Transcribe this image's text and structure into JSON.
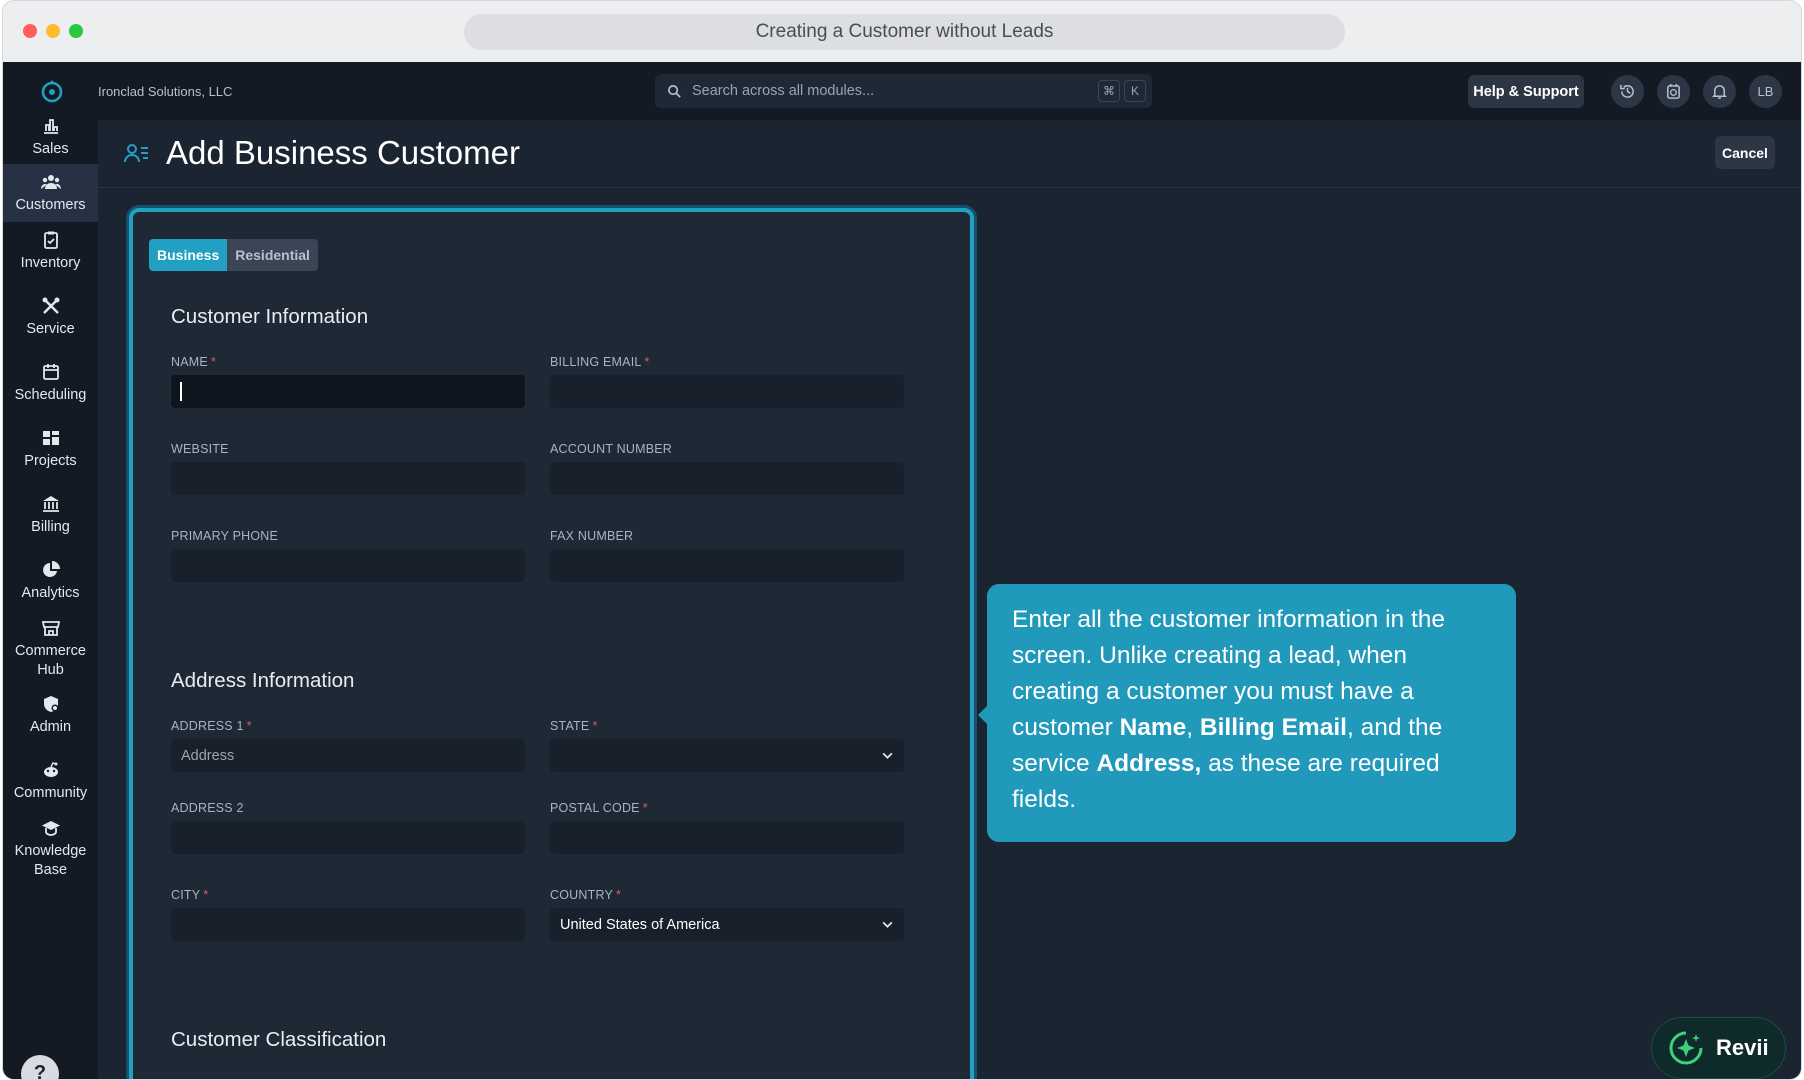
{
  "window": {
    "url_title": "Creating a Customer without Leads"
  },
  "topbar": {
    "company": "Ironclad Solutions, LLC",
    "search_placeholder": "Search across all modules...",
    "kbd_cmd": "⌘",
    "kbd_k": "K",
    "help_label": "Help & Support",
    "avatar_initials": "LB"
  },
  "sidebar": {
    "items": [
      {
        "label": "Sales",
        "icon": "bar-chart-icon"
      },
      {
        "label": "Customers",
        "icon": "users-icon",
        "active": true
      },
      {
        "label": "Inventory",
        "icon": "clipboard-check-icon"
      },
      {
        "label": "Service",
        "icon": "tools-icon"
      },
      {
        "label": "Scheduling",
        "icon": "calendar-icon"
      },
      {
        "label": "Projects",
        "icon": "projects-icon"
      },
      {
        "label": "Billing",
        "icon": "bank-icon"
      },
      {
        "label": "Analytics",
        "icon": "pie-chart-icon"
      },
      {
        "label": "Commerce Hub",
        "icon": "store-icon"
      },
      {
        "label": "Admin",
        "icon": "admin-shield-icon"
      },
      {
        "label": "Community",
        "icon": "community-icon"
      },
      {
        "label": "Knowledge Base",
        "icon": "graduation-cap-icon"
      }
    ],
    "help": "?"
  },
  "page": {
    "title": "Add Business Customer",
    "cancel_label": "Cancel"
  },
  "form": {
    "tabs": {
      "business": "Business",
      "residential": "Residential"
    },
    "sections": {
      "customer_info": "Customer Information",
      "address_info": "Address Information",
      "classification": "Customer Classification"
    },
    "fields": {
      "name": {
        "label": "NAME",
        "required": "*"
      },
      "billing_email": {
        "label": "BILLING EMAIL",
        "required": "*"
      },
      "website": {
        "label": "WEBSITE"
      },
      "account_number": {
        "label": "ACCOUNT NUMBER"
      },
      "primary_phone": {
        "label": "PRIMARY PHONE"
      },
      "fax_number": {
        "label": "FAX NUMBER"
      },
      "address1": {
        "label": "ADDRESS 1",
        "required": "*",
        "placeholder": "Address"
      },
      "state": {
        "label": "STATE",
        "required": "*"
      },
      "address2": {
        "label": "ADDRESS 2"
      },
      "postal_code": {
        "label": "POSTAL CODE",
        "required": "*"
      },
      "city": {
        "label": "CITY",
        "required": "*"
      },
      "country": {
        "label": "COUNTRY",
        "required": "*",
        "value": "United States of America"
      }
    }
  },
  "tooltip": {
    "t1": "Enter all the customer information in the screen. Unlike creating a lead, when creating a customer you must have a customer ",
    "b1": "Name",
    "t2": ", ",
    "b2": "Billing Email",
    "t3": ", and the service ",
    "b3": "Address,",
    "t4": " as these are required fields."
  },
  "assistant": {
    "label": "Revii"
  },
  "colors": {
    "accent": "#21a0c3",
    "tooltip": "#2199ba",
    "required": "#e05a6a"
  }
}
